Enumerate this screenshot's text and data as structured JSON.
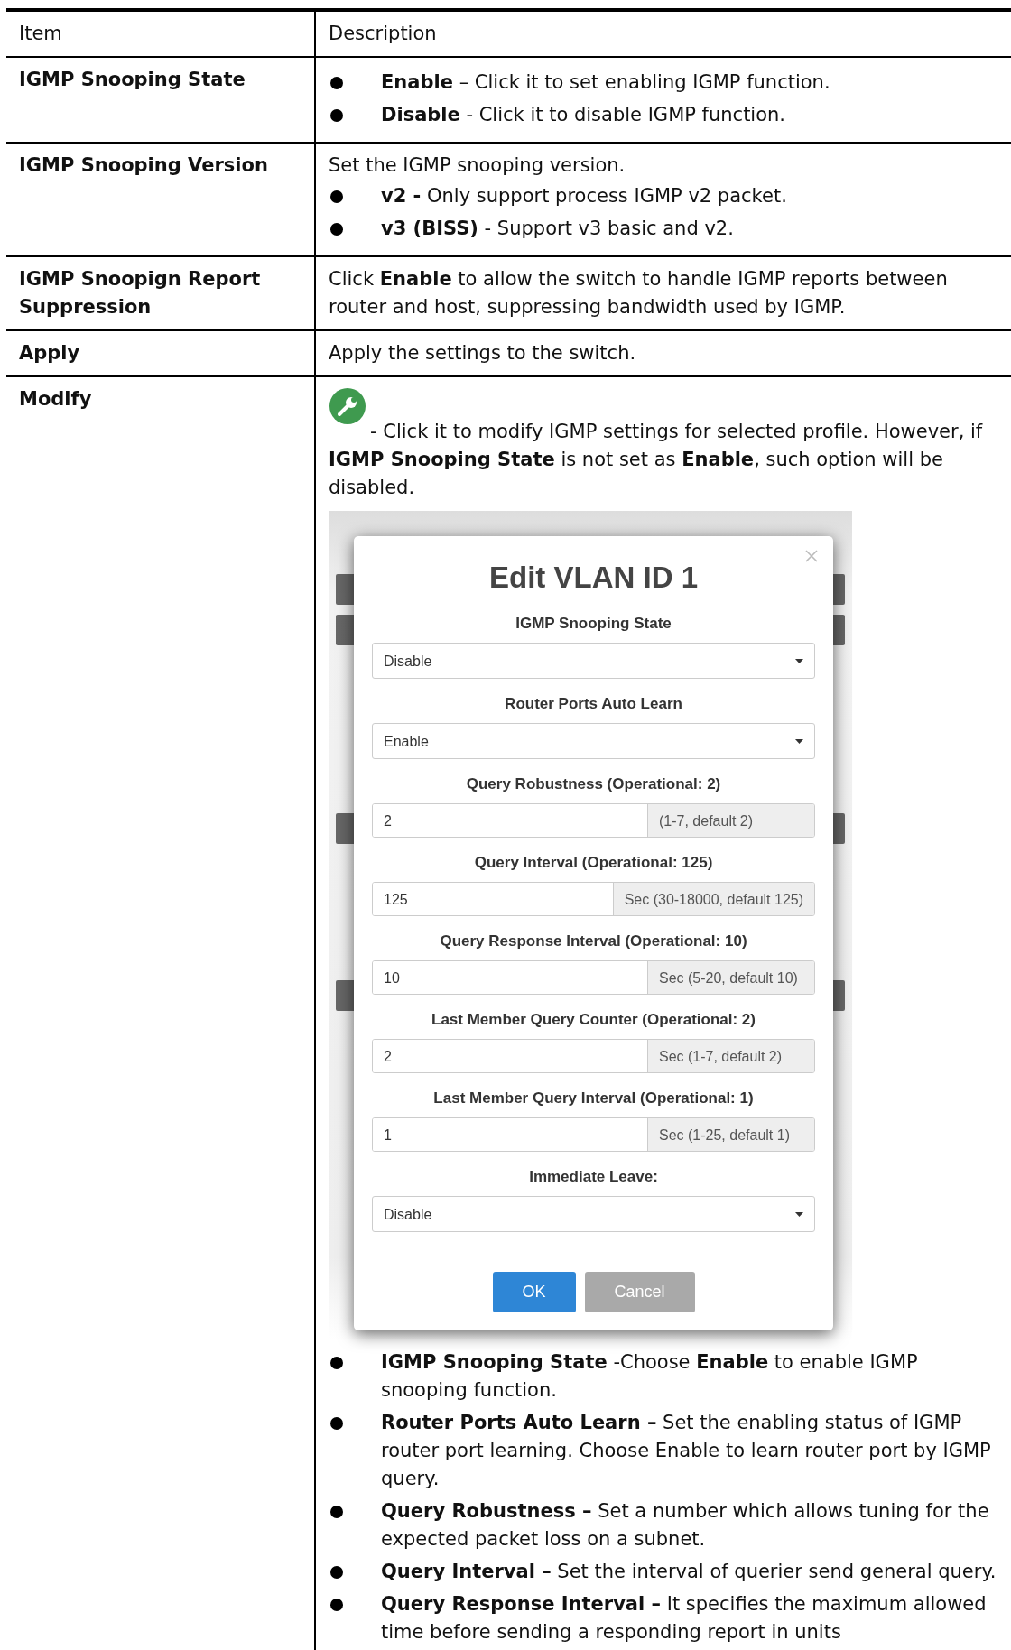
{
  "table": {
    "columns": [
      "Item",
      "Description"
    ],
    "rows": [
      {
        "item": "IGMP Snooping State",
        "content": [
          {
            "kind": "bullet",
            "text": "**Enable** – Click it to set enabling IGMP function."
          },
          {
            "kind": "bullet",
            "text": "**Disable** - Click it to disable IGMP function."
          }
        ]
      },
      {
        "item": "IGMP Snooping Version",
        "content": [
          {
            "kind": "paragraph",
            "text": "Set the IGMP snooping version."
          },
          {
            "kind": "bullet",
            "text": "**v2 -** Only support process IGMP v2 packet."
          },
          {
            "kind": "bullet",
            "text": "**v3 (BISS)** - Support v3 basic and v2."
          }
        ]
      },
      {
        "item": "IGMP Snoopign Report Suppression",
        "content": [
          {
            "kind": "paragraph",
            "text": "Click **Enable** to allow the switch to handle IGMP reports between router and host, suppressing bandwidth used by IGMP."
          }
        ]
      },
      {
        "item": "Apply",
        "content": [
          {
            "kind": "paragraph",
            "text": "Apply the settings to the switch."
          }
        ]
      },
      {
        "item": "Modify",
        "content": [
          {
            "kind": "icon_paragraph",
            "text": "- Click it to modify IGMP settings for selected profile. However, if **IGMP Snooping State** is not set as **Enable**, such option will be disabled."
          },
          {
            "kind": "screenshot",
            "dialog": {
              "title": "Edit VLAN ID 1",
              "fields": [
                {
                  "kind": "select",
                  "label": "IGMP Snooping State",
                  "value": "Disable"
                },
                {
                  "kind": "select",
                  "label": "Router Ports Auto Learn",
                  "value": "Enable"
                },
                {
                  "kind": "input",
                  "label": "Query Robustness (Operational: 2)",
                  "value": "2",
                  "addon": "(1-7, default 2)"
                },
                {
                  "kind": "input",
                  "label": "Query Interval (Operational: 125)",
                  "value": "125",
                  "addon": "Sec (30-18000, default 125)"
                },
                {
                  "kind": "input",
                  "label": "Query Response Interval (Operational: 10)",
                  "value": "10",
                  "addon": "Sec (5-20, default 10)"
                },
                {
                  "kind": "input",
                  "label": "Last Member Query Counter (Operational: 2)",
                  "value": "2",
                  "addon": "Sec (1-7, default 2)"
                },
                {
                  "kind": "input",
                  "label": "Last Member Query Interval (Operational: 1)",
                  "value": "1",
                  "addon": "Sec (1-25, default 1)"
                },
                {
                  "kind": "select",
                  "label": "Immediate Leave:",
                  "value": "Disable"
                }
              ],
              "buttons": [
                {
                  "kind": "primary",
                  "label": "OK"
                },
                {
                  "kind": "secondary",
                  "label": "Cancel"
                }
              ]
            }
          },
          {
            "kind": "bullet",
            "text": "**IGMP Snooping State** -Choose **Enable** to enable IGMP snooping function."
          },
          {
            "kind": "bullet",
            "text": "**Router Ports Auto Learn –** Set the enabling status of IGMP router port learning. Choose Enable to learn router port by IGMP query."
          },
          {
            "kind": "bullet",
            "text": "**Query Robustness –** Set a number which allows tuning for the expected packet loss on a subnet."
          },
          {
            "kind": "bullet",
            "text": "**Query Interval –** Set the interval of querier send general query."
          },
          {
            "kind": "bullet",
            "text": "**Query Response Interval –** It specifies the maximum allowed time before sending a responding report in units"
          }
        ]
      }
    ]
  }
}
